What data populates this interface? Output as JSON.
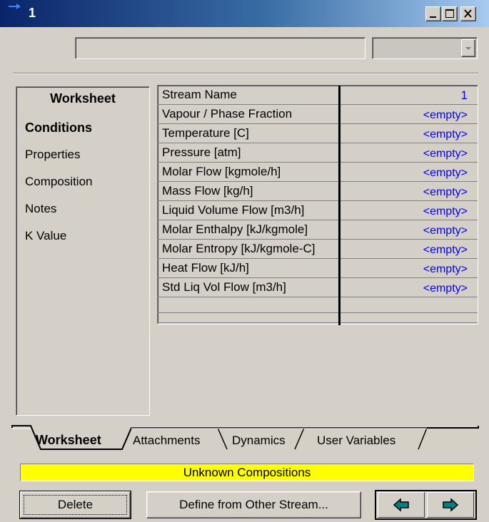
{
  "window": {
    "title": "1"
  },
  "stream_name_field": {
    "value": ""
  },
  "fluid_package_combo": {
    "value": ""
  },
  "nav": {
    "header": "Worksheet",
    "items": [
      {
        "label": "Conditions",
        "active": true
      },
      {
        "label": "Properties",
        "active": false
      },
      {
        "label": "Composition",
        "active": false
      },
      {
        "label": "Notes",
        "active": false
      },
      {
        "label": "K Value",
        "active": false
      }
    ]
  },
  "conditions": {
    "rows": [
      {
        "name": "Stream Name",
        "value": "1"
      },
      {
        "name": "Vapour / Phase Fraction",
        "value": "<empty>"
      },
      {
        "name": "Temperature [C]",
        "value": "<empty>"
      },
      {
        "name": "Pressure [atm]",
        "value": "<empty>"
      },
      {
        "name": "Molar Flow [kgmole/h]",
        "value": "<empty>"
      },
      {
        "name": "Mass Flow [kg/h]",
        "value": "<empty>"
      },
      {
        "name": "Liquid Volume Flow [m3/h]",
        "value": "<empty>"
      },
      {
        "name": "Molar Enthalpy [kJ/kgmole]",
        "value": "<empty>"
      },
      {
        "name": "Molar Entropy [kJ/kgmole-C]",
        "value": "<empty>"
      },
      {
        "name": "Heat Flow [kJ/h]",
        "value": "<empty>"
      },
      {
        "name": "Std Liq Vol Flow [m3/h]",
        "value": "<empty>"
      },
      {
        "name": "",
        "value": ""
      }
    ]
  },
  "tabs": [
    {
      "label": "Worksheet",
      "active": true
    },
    {
      "label": "Attachments",
      "active": false
    },
    {
      "label": "Dynamics",
      "active": false
    },
    {
      "label": "User Variables",
      "active": false
    }
  ],
  "status": {
    "text": "Unknown Compositions",
    "color": "#ffff00"
  },
  "buttons": {
    "delete": "Delete",
    "define": "Define from Other Stream..."
  },
  "colors": {
    "value_text": "#0000ff",
    "title_start": "#0a246a",
    "title_end": "#a6caf0"
  }
}
